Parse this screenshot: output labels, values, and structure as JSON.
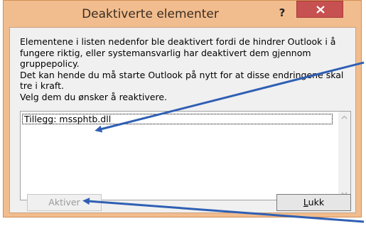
{
  "dialog": {
    "title": "Deaktiverte elementer",
    "help_label": "?",
    "description": [
      "Elementene i listen nedenfor ble deaktivert fordi de hindrer Outlook i å fungere riktig, eller systemansvarlig har deaktivert dem gjennom gruppepolicy.",
      "Det kan hende du må starte Outlook på nytt for at disse endringene skal tre i kraft.",
      "Velg dem du ønsker å reaktivere."
    ],
    "list_items": [
      "Tillegg: mssphtb.dll"
    ],
    "buttons": {
      "activate_label": "Aktiver",
      "close_label_underlined": "L",
      "close_label_rest": "ukk"
    }
  },
  "icons": [
    "help-icon",
    "close-icon",
    "scroll-up-icon",
    "scroll-down-icon"
  ],
  "colors": {
    "frame": "#f2bd8e",
    "close_button": "#c75050",
    "arrow": "#2f5fb3"
  }
}
